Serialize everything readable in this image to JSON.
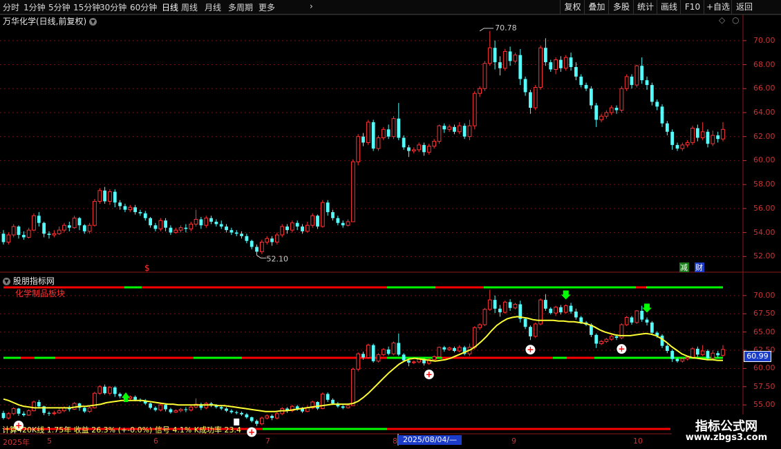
{
  "toolbar": {
    "periods": [
      {
        "label": "分时",
        "active": false
      },
      {
        "label": "1分钟",
        "active": false
      },
      {
        "label": "5分钟",
        "active": false
      },
      {
        "label": "15分钟",
        "active": false
      },
      {
        "label": "30分钟",
        "active": false
      },
      {
        "label": "60分钟",
        "active": false
      },
      {
        "label": "日线",
        "active": true
      },
      {
        "label": "周线",
        "active": false
      },
      {
        "label": "月线",
        "active": false
      },
      {
        "label": "多周期",
        "active": false
      },
      {
        "label": "更多",
        "active": false
      }
    ],
    "more_arrow": "›",
    "tools": [
      "复权",
      "叠加",
      "多股",
      "统计",
      "画线",
      "F10",
      "+自选",
      "返回"
    ]
  },
  "price_panel": {
    "title": "万华化学(日线,前复权)",
    "high_label": "70.78",
    "low_label": "52.10",
    "y_ticks": [
      "70.00",
      "68.00",
      "66.00",
      "64.00",
      "62.00",
      "60.00",
      "58.00",
      "56.00",
      "54.00",
      "52.00"
    ],
    "markers": {
      "s": "$",
      "jian": "减",
      "cai": "财"
    }
  },
  "indicator_panel": {
    "title": "股朋指标网",
    "subtitle": "化学制品板块",
    "y_ticks": [
      "70.00",
      "67.50",
      "65.00",
      "62.50",
      "60.00",
      "57.50",
      "55.00"
    ],
    "current_value": "60.99",
    "stats_text": "计算420K线 1.75年 收益 26.3% (+-0.0%) 信号 4.1% K成功率 23.4"
  },
  "x_axis": {
    "labels": [
      "2025年",
      "5",
      "6",
      "7",
      "8",
      "9",
      "10"
    ],
    "cursor_date": "2025/08/04/—"
  },
  "watermark": {
    "title": "指标公式网",
    "url": "www.zbgs3.com"
  },
  "colors": {
    "up": "#ff3333",
    "down": "#54fcfc",
    "ma": "#ffff33",
    "grid": "#7a1010",
    "line_green": "#00ff00",
    "line_red": "#ff0000"
  },
  "chart_data": {
    "type": "candlestick",
    "ylim": [
      51.5,
      71.2
    ],
    "candles": [
      [
        53.9,
        53.2,
        54.2,
        53.0
      ],
      [
        53.2,
        53.8,
        54.0,
        53.0
      ],
      [
        53.8,
        54.5,
        54.7,
        53.6
      ],
      [
        54.5,
        53.8,
        54.6,
        53.5
      ],
      [
        53.8,
        53.6,
        54.1,
        53.4
      ],
      [
        53.6,
        54.2,
        54.4,
        53.5
      ],
      [
        54.2,
        55.4,
        55.6,
        54.1
      ],
      [
        55.4,
        54.8,
        55.7,
        54.5
      ],
      [
        54.8,
        53.9,
        54.9,
        53.6
      ],
      [
        53.9,
        53.8,
        54.1,
        53.5
      ],
      [
        53.8,
        53.9,
        54.2,
        53.6
      ],
      [
        53.9,
        54.2,
        54.5,
        53.8
      ],
      [
        54.2,
        54.6,
        54.8,
        54.0
      ],
      [
        54.6,
        54.4,
        54.9,
        54.1
      ],
      [
        54.4,
        55.2,
        55.4,
        54.3
      ],
      [
        55.2,
        54.6,
        55.3,
        54.2
      ],
      [
        54.6,
        54.1,
        54.7,
        53.9
      ],
      [
        54.1,
        54.6,
        54.8,
        53.9
      ],
      [
        54.6,
        56.6,
        56.8,
        54.5
      ],
      [
        56.6,
        57.5,
        57.7,
        56.4
      ],
      [
        57.5,
        56.6,
        57.8,
        56.4
      ],
      [
        56.6,
        57.4,
        57.6,
        56.3
      ],
      [
        57.4,
        56.5,
        57.6,
        56.1
      ],
      [
        56.5,
        56.2,
        56.7,
        55.9
      ],
      [
        56.2,
        55.9,
        56.4,
        55.7
      ],
      [
        55.9,
        56.1,
        56.3,
        55.7
      ],
      [
        56.1,
        55.7,
        56.3,
        55.5
      ],
      [
        55.7,
        55.6,
        55.9,
        55.4
      ],
      [
        55.6,
        55.2,
        55.8,
        55.0
      ],
      [
        55.2,
        54.6,
        55.3,
        54.4
      ],
      [
        54.6,
        54.3,
        54.8,
        54.1
      ],
      [
        54.3,
        55.0,
        55.2,
        54.1
      ],
      [
        55.0,
        54.4,
        55.2,
        54.1
      ],
      [
        54.4,
        54.0,
        54.6,
        53.8
      ],
      [
        54.0,
        54.2,
        54.4,
        53.9
      ],
      [
        54.2,
        54.4,
        54.6,
        54.0
      ],
      [
        54.4,
        54.3,
        54.7,
        54.0
      ],
      [
        54.3,
        54.7,
        54.9,
        54.1
      ],
      [
        54.7,
        55.1,
        55.9,
        54.5
      ],
      [
        55.1,
        54.6,
        55.3,
        54.3
      ],
      [
        54.6,
        55.2,
        55.4,
        54.4
      ],
      [
        55.2,
        54.9,
        55.4,
        54.7
      ],
      [
        54.9,
        54.7,
        55.1,
        54.5
      ],
      [
        54.7,
        54.5,
        55.0,
        54.3
      ],
      [
        54.5,
        54.2,
        54.7,
        54.0
      ],
      [
        54.2,
        54.0,
        54.4,
        53.8
      ],
      [
        54.0,
        53.9,
        54.2,
        53.7
      ],
      [
        53.9,
        53.7,
        54.1,
        53.5
      ],
      [
        53.7,
        53.3,
        53.9,
        53.1
      ],
      [
        53.3,
        52.8,
        53.4,
        52.6
      ],
      [
        52.8,
        52.4,
        53.0,
        52.1
      ],
      [
        52.4,
        53.2,
        53.4,
        52.2
      ],
      [
        53.2,
        53.5,
        53.7,
        53.0
      ],
      [
        53.5,
        53.2,
        53.7,
        52.9
      ],
      [
        53.2,
        53.8,
        54.0,
        53.0
      ],
      [
        53.8,
        54.5,
        54.7,
        53.6
      ],
      [
        54.5,
        54.2,
        54.7,
        53.9
      ],
      [
        54.2,
        54.8,
        55.0,
        54.0
      ],
      [
        54.8,
        54.5,
        55.0,
        54.2
      ],
      [
        54.5,
        54.1,
        54.7,
        53.9
      ],
      [
        54.1,
        54.6,
        54.9,
        54.0
      ],
      [
        54.6,
        55.4,
        55.6,
        54.4
      ],
      [
        55.4,
        54.5,
        55.5,
        54.3
      ],
      [
        54.5,
        56.5,
        56.7,
        54.4
      ],
      [
        56.5,
        55.7,
        56.7,
        55.4
      ],
      [
        55.7,
        55.2,
        55.9,
        55.0
      ],
      [
        55.2,
        54.8,
        55.4,
        54.6
      ],
      [
        54.8,
        54.6,
        55.0,
        54.4
      ],
      [
        54.6,
        54.9,
        55.1,
        54.5
      ],
      [
        54.9,
        59.9,
        60.1,
        54.9
      ],
      [
        59.9,
        62.0,
        62.2,
        59.6
      ],
      [
        62.0,
        61.5,
        62.3,
        61.2
      ],
      [
        61.5,
        63.2,
        63.4,
        61.3
      ],
      [
        63.2,
        61.0,
        63.4,
        60.8
      ],
      [
        61.0,
        61.9,
        62.1,
        60.8
      ],
      [
        61.9,
        62.6,
        62.8,
        61.7
      ],
      [
        62.6,
        62.0,
        63.0,
        61.8
      ],
      [
        62.0,
        63.5,
        63.7,
        61.8
      ],
      [
        63.5,
        61.9,
        64.8,
        61.7
      ],
      [
        61.9,
        61.1,
        62.1,
        60.9
      ],
      [
        61.1,
        60.8,
        61.3,
        60.3
      ],
      [
        60.8,
        60.9,
        61.1,
        60.6
      ],
      [
        60.9,
        61.3,
        61.5,
        60.7
      ],
      [
        61.3,
        60.7,
        61.5,
        60.4
      ],
      [
        60.7,
        61.2,
        61.4,
        60.5
      ],
      [
        61.2,
        61.6,
        61.8,
        61.0
      ],
      [
        61.6,
        62.9,
        63.0,
        61.4
      ],
      [
        62.9,
        62.6,
        63.1,
        62.3
      ],
      [
        62.6,
        62.8,
        63.0,
        62.4
      ],
      [
        62.8,
        62.4,
        63.0,
        62.2
      ],
      [
        62.4,
        62.9,
        63.2,
        62.2
      ],
      [
        62.9,
        62.0,
        63.1,
        61.8
      ],
      [
        62.0,
        62.9,
        63.4,
        61.7
      ],
      [
        62.9,
        65.6,
        65.8,
        62.6
      ],
      [
        65.6,
        66.0,
        66.2,
        65.3
      ],
      [
        66.0,
        68.1,
        68.3,
        65.8
      ],
      [
        68.1,
        69.4,
        70.8,
        67.9
      ],
      [
        69.4,
        68.2,
        70.0,
        67.6
      ],
      [
        68.2,
        67.7,
        68.7,
        67.1
      ],
      [
        67.7,
        69.1,
        69.3,
        67.5
      ],
      [
        69.1,
        68.3,
        69.5,
        67.9
      ],
      [
        68.3,
        68.8,
        69.0,
        68.1
      ],
      [
        68.8,
        66.8,
        69.3,
        66.3
      ],
      [
        66.8,
        65.7,
        67.0,
        65.4
      ],
      [
        65.7,
        64.4,
        65.9,
        63.9
      ],
      [
        64.4,
        66.1,
        66.3,
        64.2
      ],
      [
        66.1,
        69.4,
        69.6,
        65.9
      ],
      [
        69.4,
        68.2,
        70.2,
        67.9
      ],
      [
        68.2,
        67.6,
        68.4,
        67.4
      ],
      [
        67.6,
        68.4,
        68.6,
        67.2
      ],
      [
        68.4,
        67.7,
        68.7,
        67.4
      ],
      [
        67.7,
        68.6,
        68.8,
        67.5
      ],
      [
        68.6,
        67.8,
        69.0,
        67.5
      ],
      [
        67.8,
        67.0,
        68.2,
        66.7
      ],
      [
        67.0,
        66.3,
        67.2,
        66.1
      ],
      [
        66.3,
        66.0,
        66.5,
        65.8
      ],
      [
        66.0,
        64.6,
        66.2,
        64.3
      ],
      [
        64.6,
        63.4,
        64.8,
        62.8
      ],
      [
        63.4,
        63.7,
        63.9,
        63.2
      ],
      [
        63.7,
        64.0,
        64.2,
        63.5
      ],
      [
        64.0,
        64.4,
        64.6,
        63.8
      ],
      [
        64.4,
        64.2,
        64.6,
        63.9
      ],
      [
        64.2,
        66.0,
        66.2,
        64.0
      ],
      [
        66.0,
        67.0,
        67.2,
        65.8
      ],
      [
        67.0,
        66.3,
        67.2,
        66.0
      ],
      [
        66.3,
        67.9,
        68.0,
        66.1
      ],
      [
        67.9,
        66.7,
        68.6,
        66.4
      ],
      [
        66.7,
        66.3,
        67.0,
        65.9
      ],
      [
        66.3,
        64.9,
        66.5,
        64.6
      ],
      [
        64.9,
        64.5,
        65.1,
        64.2
      ],
      [
        64.5,
        63.1,
        64.7,
        62.8
      ],
      [
        63.1,
        62.4,
        63.3,
        62.1
      ],
      [
        62.4,
        61.3,
        62.6,
        60.9
      ],
      [
        61.3,
        61.0,
        61.5,
        60.8
      ],
      [
        61.0,
        61.3,
        61.5,
        60.8
      ],
      [
        61.3,
        61.5,
        61.7,
        61.1
      ],
      [
        61.5,
        62.7,
        62.9,
        61.3
      ],
      [
        62.7,
        61.9,
        63.0,
        61.6
      ],
      [
        61.9,
        62.4,
        63.2,
        61.7
      ],
      [
        62.4,
        61.4,
        62.6,
        61.1
      ],
      [
        61.4,
        62.1,
        62.5,
        61.2
      ],
      [
        62.1,
        61.8,
        62.4,
        61.5
      ],
      [
        61.8,
        62.6,
        63.2,
        61.6
      ]
    ],
    "ma_line": [
      55.8,
      55.6,
      55.3,
      55.0,
      54.8,
      54.7,
      54.6,
      54.6,
      54.6,
      54.6,
      54.6,
      54.6,
      54.6,
      54.6,
      54.7,
      54.8,
      54.8,
      54.9,
      55.0,
      55.1,
      55.3,
      55.4,
      55.5,
      55.6,
      55.6,
      55.6,
      55.6,
      55.6,
      55.5,
      55.4,
      55.3,
      55.2,
      55.1,
      55.1,
      55.0,
      55.0,
      55.0,
      55.0,
      55.0,
      55.0,
      55.0,
      55.0,
      54.9,
      54.9,
      54.8,
      54.7,
      54.6,
      54.5,
      54.4,
      54.3,
      54.2,
      54.1,
      54.1,
      54.1,
      54.2,
      54.2,
      54.3,
      54.4,
      54.5,
      54.6,
      54.7,
      54.8,
      54.9,
      55.0,
      55.1,
      55.1,
      55.1,
      55.1,
      55.2,
      55.5,
      56.0,
      56.6,
      57.3,
      58.0,
      58.7,
      59.4,
      60.0,
      60.6,
      61.0,
      61.3,
      61.4,
      61.3,
      61.2,
      61.1,
      61.0,
      61.1,
      61.2,
      61.4,
      61.7,
      62.0,
      62.3,
      62.6,
      63.1,
      63.7,
      64.4,
      65.2,
      65.9,
      66.4,
      66.8,
      67.0,
      67.1,
      67.0,
      66.9,
      66.7,
      66.6,
      66.6,
      66.6,
      66.6,
      66.5,
      66.5,
      66.4,
      66.4,
      66.3,
      66.2,
      66.0,
      65.7,
      65.3,
      65.0,
      64.8,
      64.6,
      64.5,
      64.5,
      64.5,
      64.6,
      64.7,
      64.8,
      64.7,
      64.5,
      64.1,
      63.6,
      63.0,
      62.5,
      62.0,
      61.7,
      61.5,
      61.4,
      61.3,
      61.2,
      61.2,
      61.1,
      61.1
    ],
    "markers": [
      {
        "type": "up_arrow_green",
        "index": 176
      },
      {
        "type": "buy",
        "index": 3
      },
      {
        "type": "sell_box",
        "index": 46
      },
      {
        "type": "buy",
        "index": 49
      },
      {
        "type": "buy",
        "index": 84
      },
      {
        "type": "buy",
        "index": 104
      },
      {
        "type": "down_arrow_green",
        "index": 111
      },
      {
        "type": "buy",
        "index": 122
      },
      {
        "type": "down_arrow_green",
        "index": 127
      }
    ]
  }
}
